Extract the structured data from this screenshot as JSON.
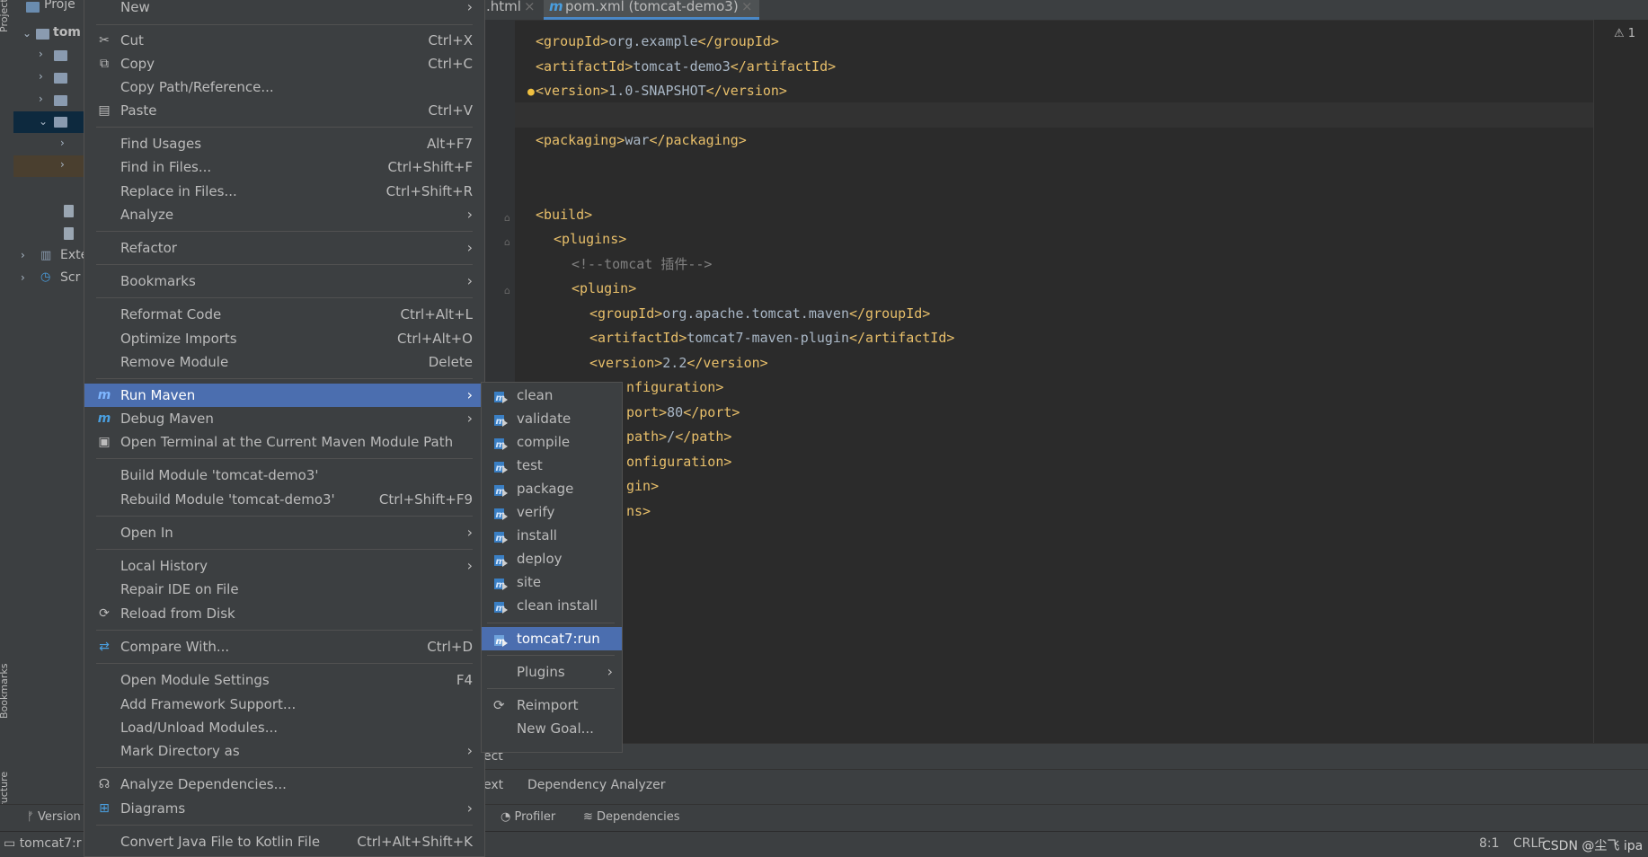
{
  "left_strip": {
    "project_label": "Project",
    "bookmarks_label": "Bookmarks",
    "structure_label": "Structure"
  },
  "project_tree": {
    "header": "Proje",
    "root": "tom",
    "external": "Exte",
    "scratches": "Scr"
  },
  "editor": {
    "tabs": [
      {
        "label": ".html"
      },
      {
        "label": "pom.xml (tomcat-demo3)"
      }
    ],
    "warning_count": "1",
    "lines": [
      {
        "tag_open": "<groupId>",
        "text": "org.example",
        "tag_close": "</groupId>"
      },
      {
        "tag_open": "<artifactId>",
        "text": "tomcat-demo3",
        "tag_close": "</artifactId>"
      },
      {
        "tag_open": "<version>",
        "text": "1.0-SNAPSHOT",
        "tag_close": "</version>"
      },
      {
        "tag_open": "<packaging>",
        "text": "war",
        "tag_close": "</packaging>"
      },
      {
        "tag_open": "<build>",
        "text": "",
        "tag_close": ""
      },
      {
        "tag_open": "<plugins>",
        "text": "",
        "tag_close": ""
      },
      {
        "comment": "<!--tomcat 插件-->"
      },
      {
        "tag_open": "<plugin>",
        "text": "",
        "tag_close": ""
      },
      {
        "tag_open": "<groupId>",
        "text": "org.apache.tomcat.maven",
        "tag_close": "</groupId>"
      },
      {
        "tag_open": "<artifactId>",
        "text": "tomcat7-maven-plugin",
        "tag_close": "</artifactId>"
      },
      {
        "tag_open": "<version>",
        "text": "2.2",
        "tag_close": "</version>"
      },
      {
        "tag_open": "nfiguration>",
        "text": "",
        "tag_close": ""
      },
      {
        "tag_open": "port>",
        "text": "80",
        "tag_close": "</port>"
      },
      {
        "tag_open": "path>",
        "text": "/",
        "tag_close": "</path>"
      },
      {
        "tag_open": "onfiguration>",
        "text": "",
        "tag_close": ""
      },
      {
        "tag_open": "gin>",
        "text": "",
        "tag_close": ""
      },
      {
        "tag_open": "ns>",
        "text": "",
        "tag_close": ""
      }
    ]
  },
  "bottom_panel": {
    "partial_line": "ect",
    "tab_partial": "ext",
    "tab_dependency_analyzer": "Dependency Analyzer"
  },
  "bottom_tools": {
    "version": "Version",
    "profiler": "Profiler",
    "dependencies": "Dependencies"
  },
  "status": {
    "run_config": "tomcat7:r",
    "position": "8:1",
    "line_sep": "CRLF",
    "watermark": "CSDN @尘飞 ipa"
  },
  "context_menu": {
    "items": [
      {
        "label": "New",
        "submenu": true
      },
      {
        "label": "Cut",
        "shortcut": "Ctrl+X",
        "icon": "scissors-icon"
      },
      {
        "label": "Copy",
        "shortcut": "Ctrl+C",
        "icon": "copy-icon"
      },
      {
        "label": "Copy Path/Reference..."
      },
      {
        "label": "Paste",
        "shortcut": "Ctrl+V",
        "icon": "paste-icon"
      },
      {
        "label": "Find Usages",
        "shortcut": "Alt+F7"
      },
      {
        "label": "Find in Files...",
        "shortcut": "Ctrl+Shift+F"
      },
      {
        "label": "Replace in Files...",
        "shortcut": "Ctrl+Shift+R"
      },
      {
        "label": "Analyze",
        "submenu": true
      },
      {
        "label": "Refactor",
        "submenu": true
      },
      {
        "label": "Bookmarks",
        "submenu": true
      },
      {
        "label": "Reformat Code",
        "shortcut": "Ctrl+Alt+L"
      },
      {
        "label": "Optimize Imports",
        "shortcut": "Ctrl+Alt+O"
      },
      {
        "label": "Remove Module",
        "shortcut": "Delete"
      },
      {
        "label": "Run Maven",
        "submenu": true,
        "icon": "maven-run-icon",
        "selected": true
      },
      {
        "label": "Debug Maven",
        "submenu": true,
        "icon": "maven-debug-icon"
      },
      {
        "label": "Open Terminal at the Current Maven Module Path",
        "icon": "terminal-icon"
      },
      {
        "label": "Build Module 'tomcat-demo3'"
      },
      {
        "label": "Rebuild Module 'tomcat-demo3'",
        "shortcut": "Ctrl+Shift+F9"
      },
      {
        "label": "Open In",
        "submenu": true
      },
      {
        "label": "Local History",
        "submenu": true
      },
      {
        "label": "Repair IDE on File"
      },
      {
        "label": "Reload from Disk",
        "icon": "reload-icon"
      },
      {
        "label": "Compare With...",
        "shortcut": "Ctrl+D",
        "icon": "compare-icon"
      },
      {
        "label": "Open Module Settings",
        "shortcut": "F4"
      },
      {
        "label": "Add Framework Support..."
      },
      {
        "label": "Load/Unload Modules..."
      },
      {
        "label": "Mark Directory as",
        "submenu": true
      },
      {
        "label": "Analyze Dependencies...",
        "icon": "analyze-dependencies-icon"
      },
      {
        "label": "Diagrams",
        "submenu": true,
        "icon": "diagram-icon"
      },
      {
        "label": "Convert Java File to Kotlin File",
        "shortcut": "Ctrl+Alt+Shift+K"
      }
    ]
  },
  "run_maven_submenu": {
    "goals": [
      "clean",
      "validate",
      "compile",
      "test",
      "package",
      "verify",
      "install",
      "deploy",
      "site",
      "clean install"
    ],
    "selected": "tomcat7:run",
    "plugins": "Plugins",
    "reimport": "Reimport",
    "new_goal": "New Goal..."
  },
  "colors": {
    "selection": "#4b6eaf",
    "panel": "#3c3f41",
    "editor_bg": "#2b2b2b",
    "xml_tag": "#e8bf6a",
    "xml_text": "#a9b7c6",
    "comment": "#808080"
  }
}
